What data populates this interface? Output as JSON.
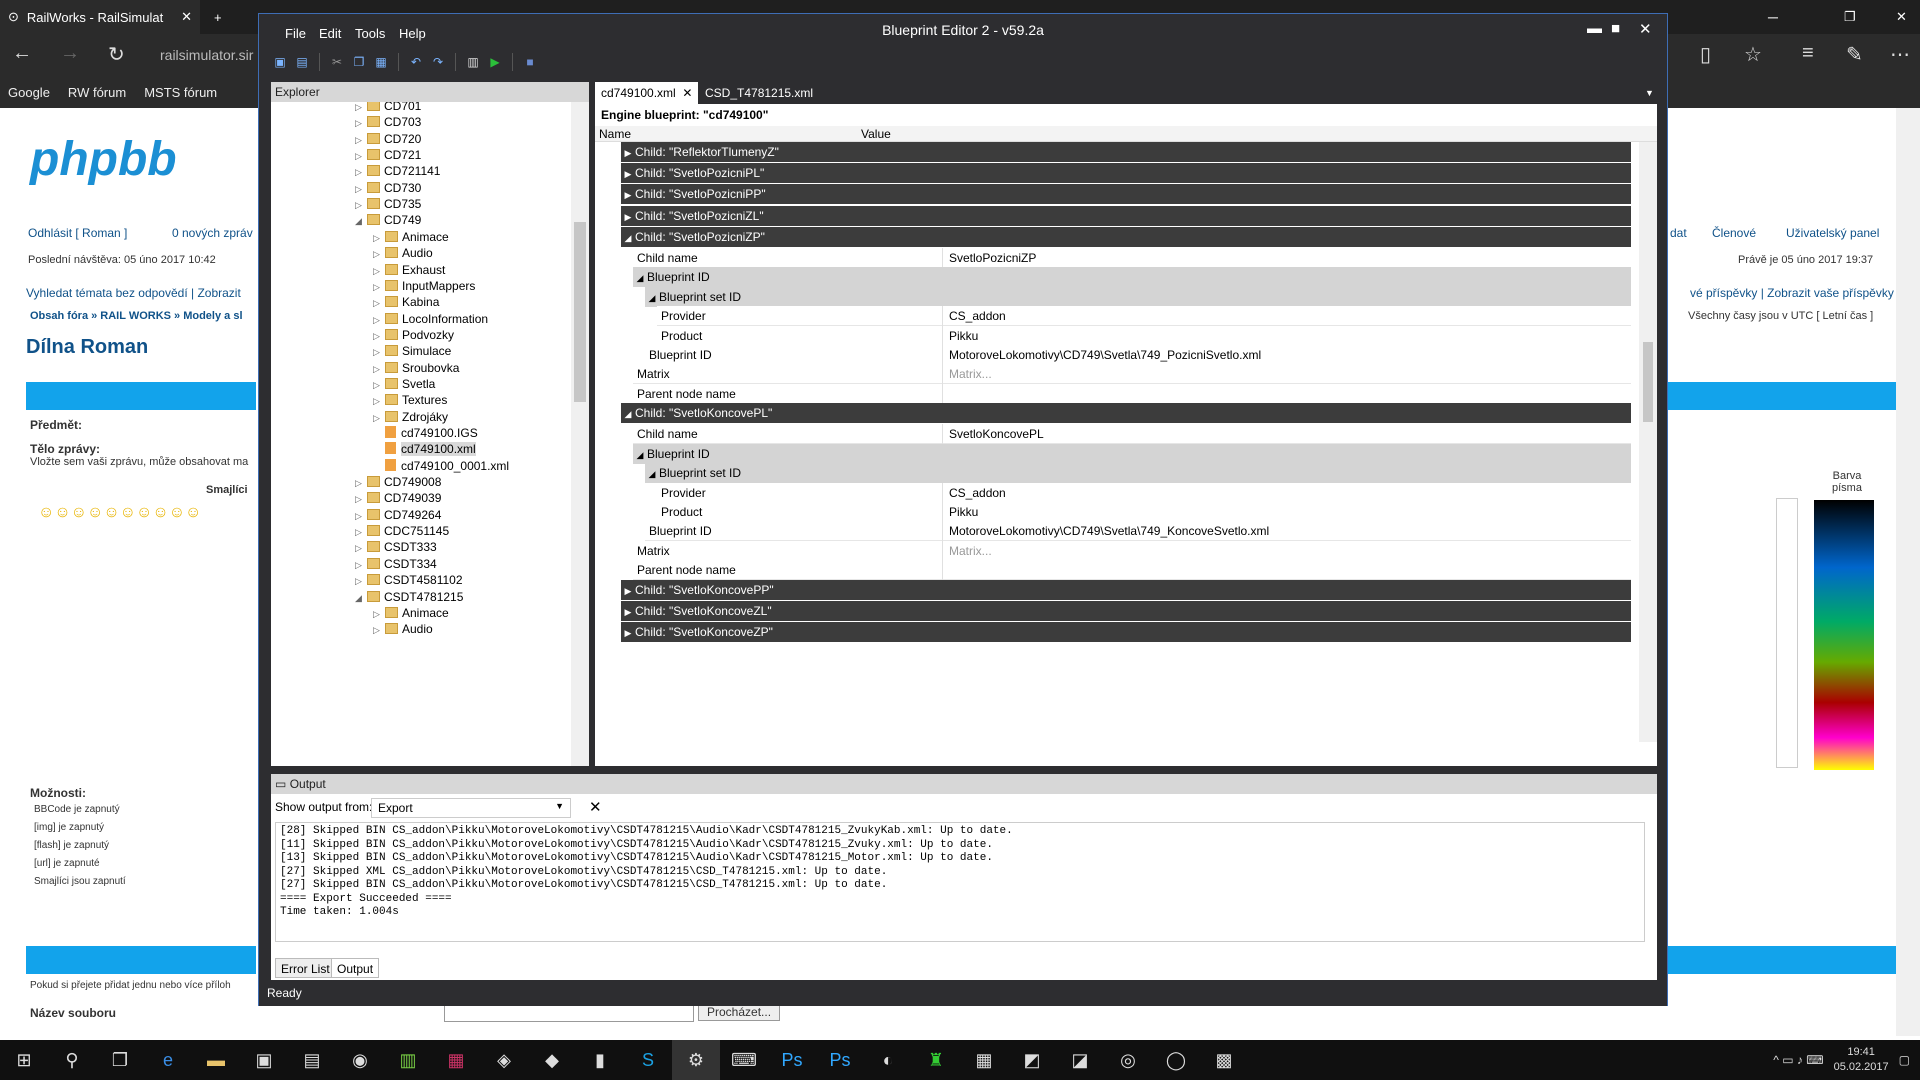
{
  "browser": {
    "tab_title": "RailWorks - RailSimulat",
    "url": "railsimulator.sir",
    "favorites": [
      "Google",
      "RW fórum",
      "MSTS fórum"
    ]
  },
  "webpage": {
    "logout": "Odhlásit [ Roman ]",
    "new_msgs": "0 nových zpráv",
    "last_visit": "Poslední návštěva: 05 úno 2017 10:42",
    "search_unanswered": "Vyhledat témata bez odpovědí | Zobrazit",
    "breadcrumb": "Obsah fóra » RAIL WORKS » Modely a sl",
    "page_title": "Dílna Roman",
    "right_nav": [
      "dat",
      "Členové",
      "Uživatelský panel"
    ],
    "now": "Právě je 05 úno 2017 19:37",
    "right_links": "vé příspěvky | Zobrazit vaše příspěvky",
    "timezone": "Všechny časy jsou v UTC [ Letní čas ]",
    "subject_label": "Předmět:",
    "body_label": "Tělo zprávy:",
    "body_hint": "Vložte sem vaši zprávu, může obsahovat ma",
    "smileys_label": "Smajlíci",
    "color_label_1": "Barva",
    "color_label_2": "písma",
    "options_label": "Možnosti:",
    "options": [
      "BBCode je zapnutý",
      "[img] je zapnutý",
      "[flash] je zapnutý",
      "[url] je zapnuté",
      "Smajlíci jsou zapnutí"
    ],
    "attach_hint": "Pokud si přejete přidat jednu nebo více příloh",
    "file_label": "Název souboru",
    "browse_btn": "Procházet..."
  },
  "editor": {
    "title": "Blueprint Editor 2 - v59.2a",
    "menu": [
      "File",
      "Edit",
      "Tools",
      "Help"
    ],
    "explorer_title": "Explorer",
    "tree": [
      {
        "label": "CD701",
        "level": 0,
        "type": "folder",
        "state": "collapsed"
      },
      {
        "label": "CD703",
        "level": 0,
        "type": "folder",
        "state": "collapsed"
      },
      {
        "label": "CD720",
        "level": 0,
        "type": "folder",
        "state": "collapsed"
      },
      {
        "label": "CD721",
        "level": 0,
        "type": "folder",
        "state": "collapsed"
      },
      {
        "label": "CD721141",
        "level": 0,
        "type": "folder",
        "state": "collapsed"
      },
      {
        "label": "CD730",
        "level": 0,
        "type": "folder",
        "state": "collapsed"
      },
      {
        "label": "CD735",
        "level": 0,
        "type": "folder",
        "state": "collapsed"
      },
      {
        "label": "CD749",
        "level": 0,
        "type": "folder",
        "state": "expanded"
      },
      {
        "label": "Animace",
        "level": 1,
        "type": "folder",
        "state": "collapsed"
      },
      {
        "label": "Audio",
        "level": 1,
        "type": "folder",
        "state": "collapsed"
      },
      {
        "label": "Exhaust",
        "level": 1,
        "type": "folder",
        "state": "collapsed"
      },
      {
        "label": "InputMappers",
        "level": 1,
        "type": "folder",
        "state": "collapsed"
      },
      {
        "label": "Kabina",
        "level": 1,
        "type": "folder",
        "state": "collapsed"
      },
      {
        "label": "LocoInformation",
        "level": 1,
        "type": "folder",
        "state": "collapsed"
      },
      {
        "label": "Podvozky",
        "level": 1,
        "type": "folder",
        "state": "collapsed"
      },
      {
        "label": "Simulace",
        "level": 1,
        "type": "folder",
        "state": "collapsed"
      },
      {
        "label": "Sroubovka",
        "level": 1,
        "type": "folder",
        "state": "collapsed"
      },
      {
        "label": "Svetla",
        "level": 1,
        "type": "folder",
        "state": "collapsed"
      },
      {
        "label": "Textures",
        "level": 1,
        "type": "folder",
        "state": "collapsed"
      },
      {
        "label": "Zdrojáky",
        "level": 1,
        "type": "folder",
        "state": "collapsed"
      },
      {
        "label": "cd749100.IGS",
        "level": 1,
        "type": "file",
        "state": "none"
      },
      {
        "label": "cd749100.xml",
        "level": 1,
        "type": "file",
        "state": "selected"
      },
      {
        "label": "cd749100_0001.xml",
        "level": 1,
        "type": "file",
        "state": "none"
      },
      {
        "label": "CD749008",
        "level": 0,
        "type": "folder",
        "state": "collapsed"
      },
      {
        "label": "CD749039",
        "level": 0,
        "type": "folder",
        "state": "collapsed"
      },
      {
        "label": "CD749264",
        "level": 0,
        "type": "folder",
        "state": "collapsed"
      },
      {
        "label": "CDC751145",
        "level": 0,
        "type": "folder",
        "state": "collapsed"
      },
      {
        "label": "CSDT333",
        "level": 0,
        "type": "folder",
        "state": "collapsed"
      },
      {
        "label": "CSDT334",
        "level": 0,
        "type": "folder",
        "state": "collapsed"
      },
      {
        "label": "CSDT4581102",
        "level": 0,
        "type": "folder",
        "state": "collapsed"
      },
      {
        "label": "CSDT4781215",
        "level": 0,
        "type": "folder",
        "state": "expanded"
      },
      {
        "label": "Animace",
        "level": 1,
        "type": "folder",
        "state": "collapsed"
      },
      {
        "label": "Audio",
        "level": 1,
        "type": "folder",
        "state": "collapsed"
      }
    ],
    "doc_tabs": [
      "cd749100.xml",
      "CSD_T4781215.xml"
    ],
    "doc_header": "Engine blueprint: \"cd749100\"",
    "col_name": "Name",
    "col_value": "Value",
    "grid": [
      {
        "kind": "sec",
        "indent": 0,
        "label": "Child: \"ReflektorTlumenyZ\"",
        "open": false
      },
      {
        "kind": "sec",
        "indent": 0,
        "label": "Child: \"SvetloPozicniPL\"",
        "open": false
      },
      {
        "kind": "sec",
        "indent": 0,
        "label": "Child: \"SvetloPozicniPP\"",
        "open": false
      },
      {
        "kind": "sec",
        "indent": 0,
        "label": "Child: \"SvetloPozicniZL\"",
        "open": false
      },
      {
        "kind": "sec",
        "indent": 0,
        "label": "Child: \"SvetloPozicniZP\"",
        "open": true
      },
      {
        "kind": "prop",
        "indent": 1,
        "label": "Child name",
        "value": "SvetloPozicniZP"
      },
      {
        "kind": "sub",
        "indent": 1,
        "label": "Blueprint ID",
        "open": true
      },
      {
        "kind": "sub",
        "indent": 2,
        "label": "Blueprint set ID",
        "open": true
      },
      {
        "kind": "prop",
        "indent": 3,
        "label": "Provider",
        "value": "CS_addon"
      },
      {
        "kind": "prop",
        "indent": 3,
        "label": "Product",
        "value": "Pikku"
      },
      {
        "kind": "prop",
        "indent": 2,
        "label": "Blueprint ID",
        "value": "MotoroveLokomotivy\\CD749\\Svetla\\749_PozicniSvetlo.xml"
      },
      {
        "kind": "prop",
        "indent": 1,
        "label": "Matrix",
        "value": "Matrix...",
        "placeholder": true
      },
      {
        "kind": "prop",
        "indent": 1,
        "label": "Parent node name",
        "value": ""
      },
      {
        "kind": "sec",
        "indent": 0,
        "label": "Child: \"SvetloKoncovePL\"",
        "open": true
      },
      {
        "kind": "prop",
        "indent": 1,
        "label": "Child name",
        "value": "SvetloKoncovePL"
      },
      {
        "kind": "sub",
        "indent": 1,
        "label": "Blueprint ID",
        "open": true
      },
      {
        "kind": "sub",
        "indent": 2,
        "label": "Blueprint set ID",
        "open": true
      },
      {
        "kind": "prop",
        "indent": 3,
        "label": "Provider",
        "value": "CS_addon"
      },
      {
        "kind": "prop",
        "indent": 3,
        "label": "Product",
        "value": "Pikku"
      },
      {
        "kind": "prop",
        "indent": 2,
        "label": "Blueprint ID",
        "value": "MotoroveLokomotivy\\CD749\\Svetla\\749_KoncoveSvetlo.xml"
      },
      {
        "kind": "prop",
        "indent": 1,
        "label": "Matrix",
        "value": "Matrix...",
        "placeholder": true
      },
      {
        "kind": "prop",
        "indent": 1,
        "label": "Parent node name",
        "value": ""
      },
      {
        "kind": "sec",
        "indent": 0,
        "label": "Child: \"SvetloKoncovePP\"",
        "open": false
      },
      {
        "kind": "sec",
        "indent": 0,
        "label": "Child: \"SvetloKoncoveZL\"",
        "open": false
      },
      {
        "kind": "sec",
        "indent": 0,
        "label": "Child: \"SvetloKoncoveZP\"",
        "open": false
      }
    ],
    "output_title": "Output",
    "output_from_label": "Show output from:",
    "output_from_value": "Export",
    "output_lines": [
      "[28] Skipped BIN CS_addon\\Pikku\\MotoroveLokomotivy\\CSDT4781215\\Audio\\Kadr\\CSDT4781215_ZvukyKab.xml: Up to date.",
      "[11] Skipped BIN CS_addon\\Pikku\\MotoroveLokomotivy\\CSDT4781215\\Audio\\Kadr\\CSDT4781215_Zvuky.xml: Up to date.",
      "[13] Skipped BIN CS_addon\\Pikku\\MotoroveLokomotivy\\CSDT4781215\\Audio\\Kadr\\CSDT4781215_Motor.xml: Up to date.",
      "[27] Skipped XML CS_addon\\Pikku\\MotoroveLokomotivy\\CSDT4781215\\CSD_T4781215.xml: Up to date.",
      "[27] Skipped BIN CS_addon\\Pikku\\MotoroveLokomotivy\\CSDT4781215\\CSD_T4781215.xml: Up to date.",
      "==== Export Succeeded ====",
      "Time taken: 1.004s"
    ],
    "output_tabs": [
      "Error List",
      "Output"
    ],
    "status": "Ready"
  },
  "taskbar": {
    "time": "19:41",
    "date": "05.02.2017"
  },
  "colors": {
    "editor_bg": "#2d2d30",
    "section_row": "#3c3c3c",
    "subsection_row": "#d4d4d4",
    "phpbb_bar": "#12a3eb"
  }
}
